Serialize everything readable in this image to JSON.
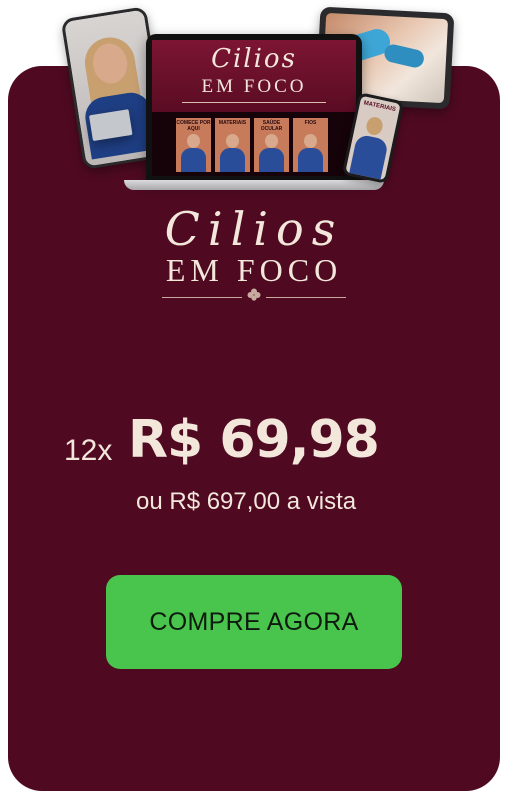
{
  "product": {
    "logo_script": "Cilios",
    "logo_caps": "EM FOCO"
  },
  "mockups": {
    "laptop_banner_script": "Cilios",
    "laptop_banner_caps": "EM FOCO",
    "modules": [
      "COMECE POR AQUI",
      "MATERIAIS",
      "SAÚDE OCULAR",
      "FIOS"
    ],
    "phone_label": "MATERIAIS"
  },
  "pricing": {
    "installments": "12x",
    "installment_price": "R$ 69,98",
    "cash_price": "ou R$ 697,00 a vista"
  },
  "cta": {
    "label": "COMPRE AGORA"
  },
  "colors": {
    "card_background": "#4f0a21",
    "text_cream": "#f3e7dc",
    "button_green": "#49c54d"
  },
  "icons": [
    "clover-icon"
  ]
}
